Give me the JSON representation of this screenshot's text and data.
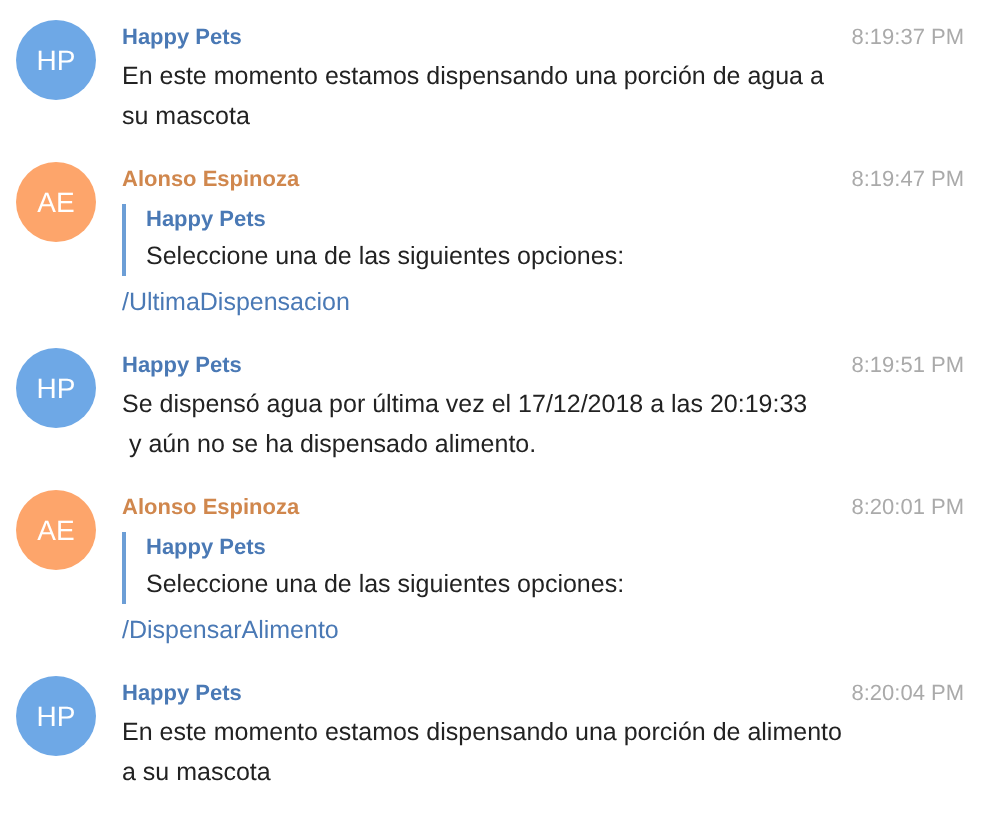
{
  "messages": [
    {
      "kind": "bot",
      "initials": "HP",
      "color": "#6ea8e6",
      "sender": "Happy Pets",
      "time": "8:19:37 PM",
      "lines": [
        "En este momento estamos dispensando una porción de agua a",
        "su mascota"
      ]
    },
    {
      "kind": "user",
      "initials": "AE",
      "color": "#fda56b",
      "sender": "Alonso Espinoza",
      "time": "8:19:47 PM",
      "reply": {
        "sender": "Happy Pets",
        "text": "Seleccione una de las siguientes opciones:"
      },
      "command": "/UltimaDispensacion"
    },
    {
      "kind": "bot",
      "initials": "HP",
      "color": "#6ea8e6",
      "sender": "Happy Pets",
      "time": "8:19:51 PM",
      "lines": [
        "Se dispensó agua por última vez el 17/12/2018 a las 20:19:33",
        " y aún no se ha dispensado alimento."
      ]
    },
    {
      "kind": "user",
      "initials": "AE",
      "color": "#fda56b",
      "sender": "Alonso Espinoza",
      "time": "8:20:01 PM",
      "reply": {
        "sender": "Happy Pets",
        "text": "Seleccione una de las siguientes opciones:"
      },
      "command": "/DispensarAlimento"
    },
    {
      "kind": "bot",
      "initials": "HP",
      "color": "#6ea8e6",
      "sender": "Happy Pets",
      "time": "8:20:04 PM",
      "lines": [
        "En este momento estamos dispensando una porción de alimento",
        "a su mascota"
      ]
    }
  ]
}
